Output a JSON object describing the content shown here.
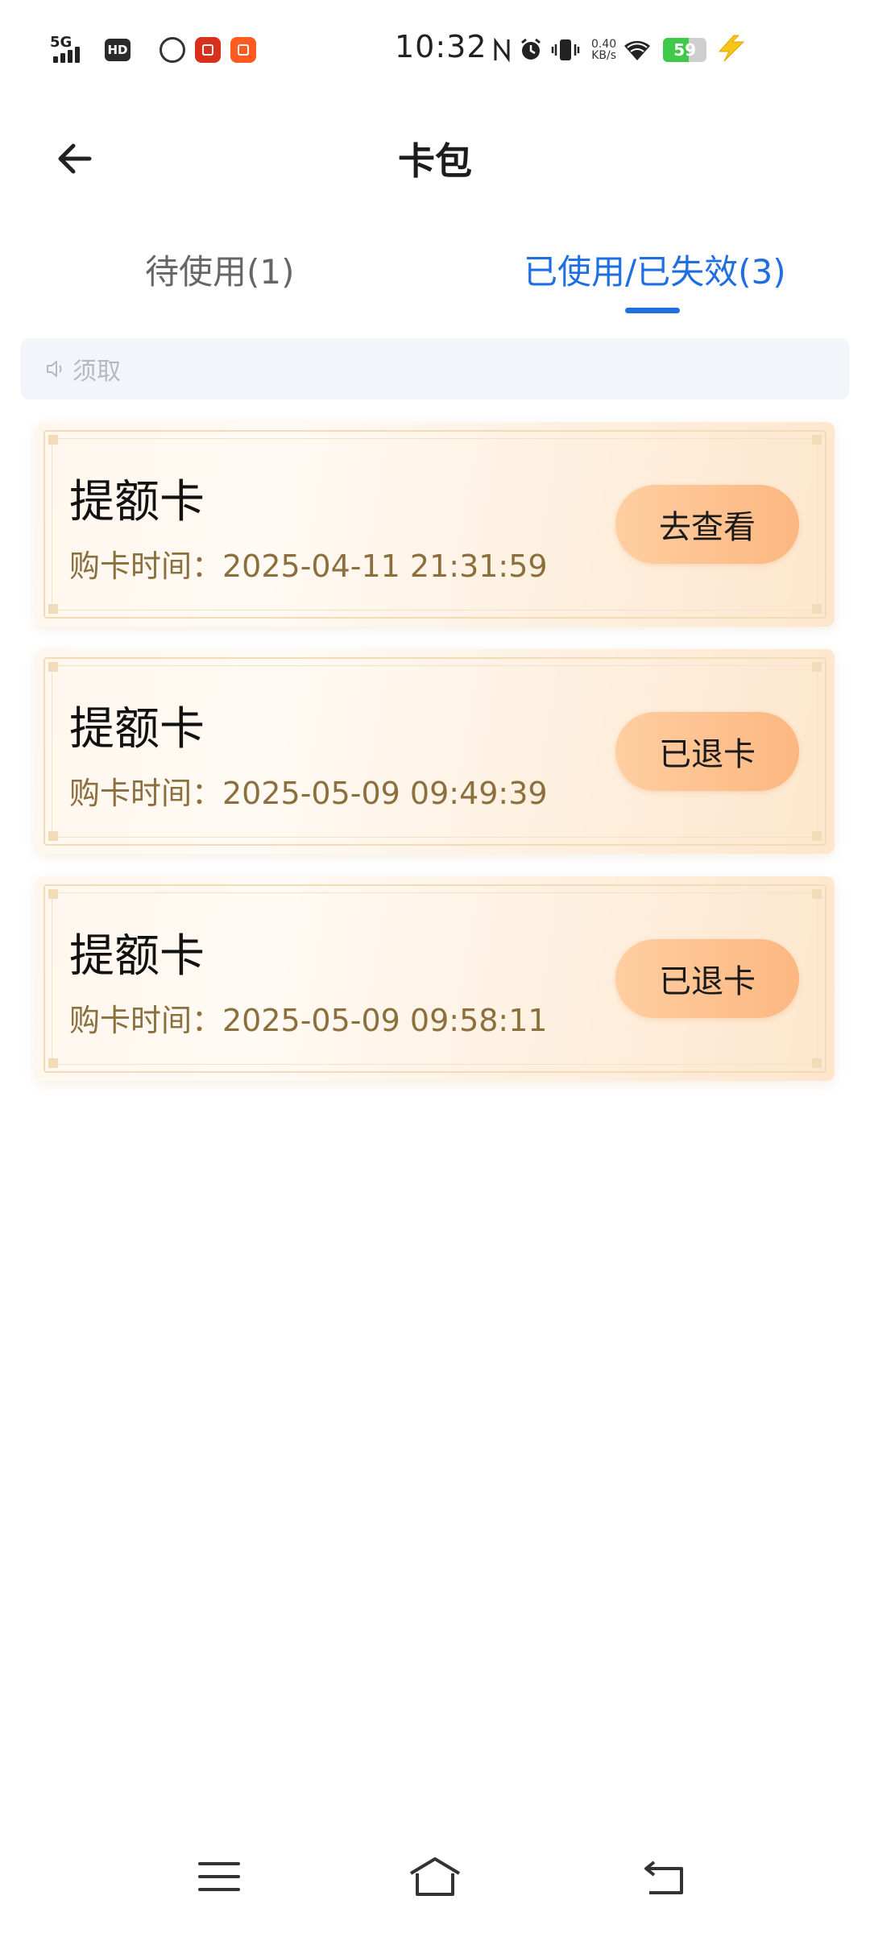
{
  "status_bar": {
    "network": "5G",
    "hd": "HD",
    "time": "10:32",
    "speed_value": "0.40",
    "speed_unit": "KB/s",
    "battery": "59",
    "battery_level": 0.59,
    "colors": {
      "battery_fill": "#3fc94a",
      "charging": "#f5c518"
    }
  },
  "header": {
    "title": "卡包",
    "back_icon": "arrow-left-icon"
  },
  "tabs": [
    {
      "label": "待使用(1)",
      "active": false
    },
    {
      "label": "已使用/已失效(3)",
      "active": true
    }
  ],
  "notice": {
    "icon": "speaker-icon",
    "text": "须取"
  },
  "cards": [
    {
      "title": "提额卡",
      "date_text": "购卡时间：2025-04-11 21:31:59",
      "button": "去查看"
    },
    {
      "title": "提额卡",
      "date_text": "购卡时间：2025-05-09 09:49:39",
      "button": "已退卡"
    },
    {
      "title": "提额卡",
      "date_text": "购卡时间：2025-05-09 09:58:11",
      "button": "已退卡"
    }
  ],
  "navbar": {
    "items": [
      "menu-icon",
      "home-icon",
      "back-icon"
    ]
  },
  "colors": {
    "accent": "#1f6fe0",
    "card_button": "#fbb781",
    "card_date": "#8b6f3c"
  }
}
